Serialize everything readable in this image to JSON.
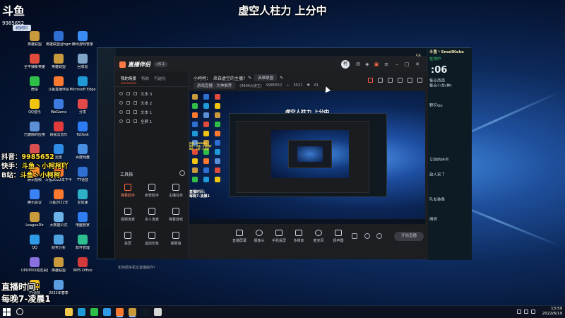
{
  "overlay": {
    "title": "虚空人柱力 上分中",
    "douyin_label": "抖音：",
    "douyin_id": "9985652",
    "kuaishou_label": "快手：",
    "kuaishou_name": "斗鱼丶小柯柯吖",
    "bilibili_label": "B站：",
    "bilibili_name": "斗鱼丶小柯柯",
    "schedule_line1": "直播时间：",
    "schedule_line2": "每晚7-凌晨1"
  },
  "logo": {
    "text": "斗鱼",
    "badge": "柯柯吖",
    "room": "9985652"
  },
  "desktop_icons": [
    {
      "label": "英雄联盟",
      "color": "#c89a3c"
    },
    {
      "label": "英雄联盟台bgm",
      "color": "#2f6fd1"
    },
    {
      "label": "腾讯游戏管家",
      "color": "#3a8cf0"
    },
    {
      "label": "全平播新英雄",
      "color": "#e04b3c"
    },
    {
      "label": "英雄联盟",
      "color": "#c89a3c"
    },
    {
      "label": "回收站",
      "color": "#7fa6c9"
    },
    {
      "label": "微信",
      "color": "#2fbf49"
    },
    {
      "label": "斗鱼直播伴侣",
      "color": "#ff7a2f"
    },
    {
      "label": "Microsoft Edge",
      "color": "#1f9ad6"
    },
    {
      "label": "QQ音乐",
      "color": "#f1c40f"
    },
    {
      "label": "WeGame",
      "color": "#3d7be0"
    },
    {
      "label": "分发",
      "color": "#e54848"
    },
    {
      "label": "已删除的应用",
      "color": "#5b8fd6"
    },
    {
      "label": "网易云音乐",
      "color": "#e23b3b"
    },
    {
      "label": "ToDesk",
      "color": "#2d7cf6"
    },
    {
      "label": "07 春节游戏",
      "color": "#d94f4f"
    },
    {
      "label": "迅雷",
      "color": "#2f8de8"
    },
    {
      "label": "百度网盘",
      "color": "#4a90e2"
    },
    {
      "label": "腾讯视频",
      "color": "#f08a24"
    },
    {
      "label": "斗鱼2022年下半年",
      "color": "#ff7a2f"
    },
    {
      "label": "TT语音",
      "color": "#2f6fd1"
    },
    {
      "label": "腾讯会议",
      "color": "#3b82f6"
    },
    {
      "label": "斗鱼2022年",
      "color": "#ff7a2f"
    },
    {
      "label": "爱加速",
      "color": "#2fb0c9"
    },
    {
      "label": "LeagueDir",
      "color": "#c89a3c"
    },
    {
      "label": "大数据公式",
      "color": "#6bb3e8"
    },
    {
      "label": "电脑管家",
      "color": "#2e7ef0"
    },
    {
      "label": "QQ",
      "color": "#2f9be8"
    },
    {
      "label": "财务分析",
      "color": "#4fa3e0"
    },
    {
      "label": "软件管理",
      "color": "#2fbf8f"
    },
    {
      "label": "UPUPOO动态桌面",
      "color": "#8a6fe0"
    },
    {
      "label": "英雄联盟",
      "color": "#c89a3c"
    },
    {
      "label": "WPS Office",
      "color": "#d33b3b"
    },
    {
      "label": "YY语音",
      "color": "#f0c020"
    },
    {
      "label": "2022年春季",
      "color": "#5a9de0"
    }
  ],
  "game": {
    "right_name": "斗鱼丶SmallKeke",
    "right_status": "在线中",
    "right_time": ":06",
    "right_lines": [
      "集合西南",
      "集合小龙(神)",
      "",
      "",
      "",
      "野区Go",
      "",
      "",
      "",
      "",
      "",
      "",
      "",
      "",
      "",
      "",
      "艾提的信号",
      "",
      "",
      "敌人来了",
      "",
      "",
      "",
      "",
      "队友装备",
      "",
      "",
      "",
      "撤退"
    ],
    "top_score": "58"
  },
  "app": {
    "name": "直播伴侣",
    "version": "v6.1",
    "avatar": "柯",
    "tabs": [
      "我的场景",
      "特效",
      "可迪化"
    ],
    "layers": [
      "文本 3",
      "文本 2",
      "文本 1",
      "全屏 1"
    ],
    "tools_title": "工具箱",
    "tools": [
      {
        "label": "弹幕助手",
        "hot": true
      },
      {
        "label": "房管助手",
        "hot": false
      },
      {
        "label": "主播任务",
        "hot": false
      },
      {
        "label": "视频连麦",
        "hot": false
      },
      {
        "label": "多人连麦",
        "hot": false
      },
      {
        "label": "弹幕游戏",
        "hot": false
      },
      {
        "label": "投屏",
        "hot": false
      },
      {
        "label": "虚拟形象",
        "hot": false
      },
      {
        "label": "弹幕墙",
        "hot": false
      }
    ],
    "bottom_hint": "如何把多机位直播操作？",
    "stream_title_label": "小柯柯：",
    "stream_title": "来自虚空的主播?",
    "category": "英雄联盟",
    "category_sub": "游戏直播 · 大神推荐",
    "room_info": "(4990大房主)",
    "room_id": "9985652",
    "hot": "5521",
    "fans": "61",
    "controls": [
      {
        "label": "直播屏幕",
        "round": false
      },
      {
        "label": "摄像头",
        "round": true
      },
      {
        "label": "手机投屏",
        "round": false
      },
      {
        "label": "多媒体",
        "round": false
      },
      {
        "label": "麦克风",
        "round": true
      },
      {
        "label": "扬声器",
        "round": false
      }
    ],
    "start_button": "开始直播"
  },
  "preview": {
    "title": "虚空人柱力 上分中",
    "social_line1": "抖音：9985652",
    "social_line2": "快手：斗鱼丶小柯柯吖",
    "social_line3": "B站：斗鱼丶小柯柯",
    "schedule_line1": "直播时间：",
    "schedule_line2": "每晚7-凌晨1"
  },
  "taskbar": {
    "time": "13:59",
    "date": "2022/6/19",
    "apps": [
      {
        "name": "file-explorer",
        "color": "#f2c94c"
      },
      {
        "name": "edge",
        "color": "#1f9ad6"
      },
      {
        "name": "wechat",
        "color": "#2fbf49"
      },
      {
        "name": "qq",
        "color": "#2f9be8"
      },
      {
        "name": "douyu",
        "color": "#ff7a2f"
      },
      {
        "name": "league",
        "color": "#c89a3c"
      },
      {
        "name": "game",
        "color": "#0f1a26"
      },
      {
        "name": "tool",
        "color": "#d8d8d8"
      }
    ]
  }
}
